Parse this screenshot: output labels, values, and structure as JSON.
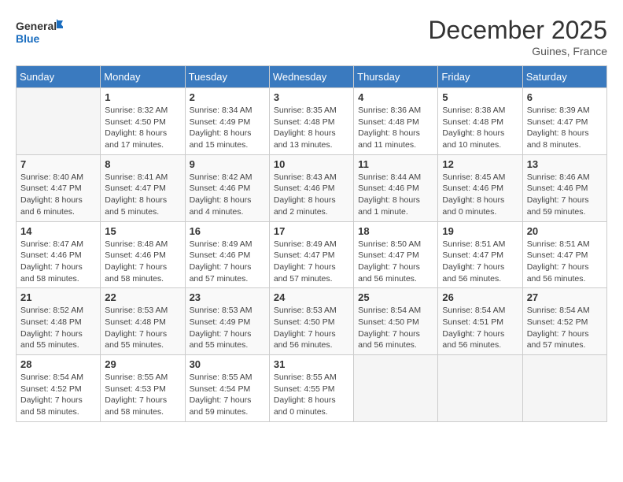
{
  "header": {
    "logo_line1": "General",
    "logo_line2": "Blue",
    "month": "December 2025",
    "location": "Guines, France"
  },
  "days_of_week": [
    "Sunday",
    "Monday",
    "Tuesday",
    "Wednesday",
    "Thursday",
    "Friday",
    "Saturday"
  ],
  "weeks": [
    [
      {
        "day": "",
        "info": ""
      },
      {
        "day": "1",
        "info": "Sunrise: 8:32 AM\nSunset: 4:50 PM\nDaylight: 8 hours\nand 17 minutes."
      },
      {
        "day": "2",
        "info": "Sunrise: 8:34 AM\nSunset: 4:49 PM\nDaylight: 8 hours\nand 15 minutes."
      },
      {
        "day": "3",
        "info": "Sunrise: 8:35 AM\nSunset: 4:48 PM\nDaylight: 8 hours\nand 13 minutes."
      },
      {
        "day": "4",
        "info": "Sunrise: 8:36 AM\nSunset: 4:48 PM\nDaylight: 8 hours\nand 11 minutes."
      },
      {
        "day": "5",
        "info": "Sunrise: 8:38 AM\nSunset: 4:48 PM\nDaylight: 8 hours\nand 10 minutes."
      },
      {
        "day": "6",
        "info": "Sunrise: 8:39 AM\nSunset: 4:47 PM\nDaylight: 8 hours\nand 8 minutes."
      }
    ],
    [
      {
        "day": "7",
        "info": "Sunrise: 8:40 AM\nSunset: 4:47 PM\nDaylight: 8 hours\nand 6 minutes."
      },
      {
        "day": "8",
        "info": "Sunrise: 8:41 AM\nSunset: 4:47 PM\nDaylight: 8 hours\nand 5 minutes."
      },
      {
        "day": "9",
        "info": "Sunrise: 8:42 AM\nSunset: 4:46 PM\nDaylight: 8 hours\nand 4 minutes."
      },
      {
        "day": "10",
        "info": "Sunrise: 8:43 AM\nSunset: 4:46 PM\nDaylight: 8 hours\nand 2 minutes."
      },
      {
        "day": "11",
        "info": "Sunrise: 8:44 AM\nSunset: 4:46 PM\nDaylight: 8 hours\nand 1 minute."
      },
      {
        "day": "12",
        "info": "Sunrise: 8:45 AM\nSunset: 4:46 PM\nDaylight: 8 hours\nand 0 minutes."
      },
      {
        "day": "13",
        "info": "Sunrise: 8:46 AM\nSunset: 4:46 PM\nDaylight: 7 hours\nand 59 minutes."
      }
    ],
    [
      {
        "day": "14",
        "info": "Sunrise: 8:47 AM\nSunset: 4:46 PM\nDaylight: 7 hours\nand 58 minutes."
      },
      {
        "day": "15",
        "info": "Sunrise: 8:48 AM\nSunset: 4:46 PM\nDaylight: 7 hours\nand 58 minutes."
      },
      {
        "day": "16",
        "info": "Sunrise: 8:49 AM\nSunset: 4:46 PM\nDaylight: 7 hours\nand 57 minutes."
      },
      {
        "day": "17",
        "info": "Sunrise: 8:49 AM\nSunset: 4:47 PM\nDaylight: 7 hours\nand 57 minutes."
      },
      {
        "day": "18",
        "info": "Sunrise: 8:50 AM\nSunset: 4:47 PM\nDaylight: 7 hours\nand 56 minutes."
      },
      {
        "day": "19",
        "info": "Sunrise: 8:51 AM\nSunset: 4:47 PM\nDaylight: 7 hours\nand 56 minutes."
      },
      {
        "day": "20",
        "info": "Sunrise: 8:51 AM\nSunset: 4:47 PM\nDaylight: 7 hours\nand 56 minutes."
      }
    ],
    [
      {
        "day": "21",
        "info": "Sunrise: 8:52 AM\nSunset: 4:48 PM\nDaylight: 7 hours\nand 55 minutes."
      },
      {
        "day": "22",
        "info": "Sunrise: 8:53 AM\nSunset: 4:48 PM\nDaylight: 7 hours\nand 55 minutes."
      },
      {
        "day": "23",
        "info": "Sunrise: 8:53 AM\nSunset: 4:49 PM\nDaylight: 7 hours\nand 55 minutes."
      },
      {
        "day": "24",
        "info": "Sunrise: 8:53 AM\nSunset: 4:50 PM\nDaylight: 7 hours\nand 56 minutes."
      },
      {
        "day": "25",
        "info": "Sunrise: 8:54 AM\nSunset: 4:50 PM\nDaylight: 7 hours\nand 56 minutes."
      },
      {
        "day": "26",
        "info": "Sunrise: 8:54 AM\nSunset: 4:51 PM\nDaylight: 7 hours\nand 56 minutes."
      },
      {
        "day": "27",
        "info": "Sunrise: 8:54 AM\nSunset: 4:52 PM\nDaylight: 7 hours\nand 57 minutes."
      }
    ],
    [
      {
        "day": "28",
        "info": "Sunrise: 8:54 AM\nSunset: 4:52 PM\nDaylight: 7 hours\nand 58 minutes."
      },
      {
        "day": "29",
        "info": "Sunrise: 8:55 AM\nSunset: 4:53 PM\nDaylight: 7 hours\nand 58 minutes."
      },
      {
        "day": "30",
        "info": "Sunrise: 8:55 AM\nSunset: 4:54 PM\nDaylight: 7 hours\nand 59 minutes."
      },
      {
        "day": "31",
        "info": "Sunrise: 8:55 AM\nSunset: 4:55 PM\nDaylight: 8 hours\nand 0 minutes."
      },
      {
        "day": "",
        "info": ""
      },
      {
        "day": "",
        "info": ""
      },
      {
        "day": "",
        "info": ""
      }
    ]
  ]
}
